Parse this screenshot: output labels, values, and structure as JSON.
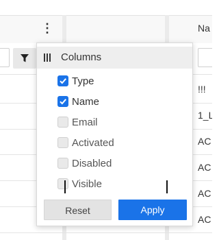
{
  "grid": {
    "header_menu_glyph": "⋮",
    "name_column_header": "Na",
    "rows": [
      "!!!",
      "1_L",
      "AC",
      "AC",
      "AC",
      "AC"
    ]
  },
  "popup": {
    "title": "Columns",
    "title_icon": "columns-icon",
    "options": [
      {
        "label": "Type",
        "checked": true
      },
      {
        "label": "Name",
        "checked": true
      },
      {
        "label": "Email",
        "checked": false
      },
      {
        "label": "Activated",
        "checked": false
      },
      {
        "label": "Disabled",
        "checked": false
      },
      {
        "label": "Visible",
        "checked": false
      }
    ],
    "reset_label": "Reset",
    "apply_label": "Apply"
  },
  "colors": {
    "accent": "#1a73e8",
    "header_bg": "#eeeeee"
  }
}
